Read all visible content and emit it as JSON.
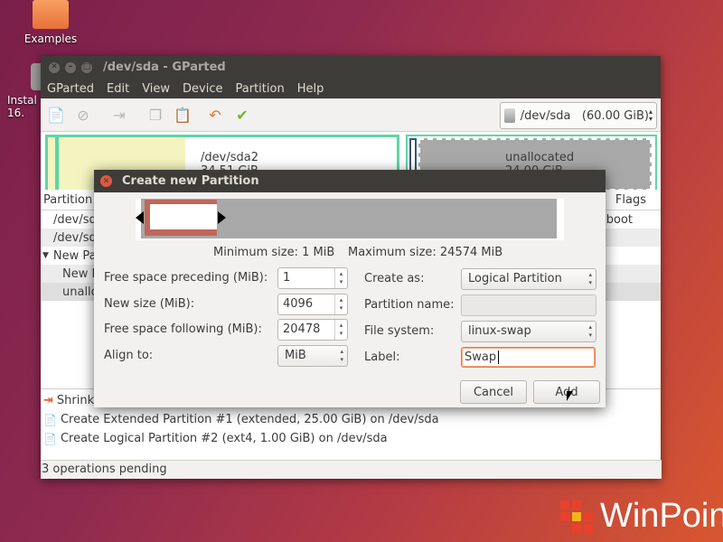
{
  "desktop": {
    "examples_label": "Examples",
    "install_label": "Instal\n16."
  },
  "window": {
    "title": "/dev/sda - GParted",
    "menu": [
      "GParted",
      "Edit",
      "View",
      "Device",
      "Partition",
      "Help"
    ],
    "device_selector": "/dev/sda   (60.00 GiB)",
    "diskmap": {
      "sda2_name": "/dev/sda2",
      "sda2_size": "34.51 GiB",
      "unalloc_name": "unallocated",
      "unalloc_size": "24.00 GiB"
    },
    "partition_list": {
      "col_partition": "Partition",
      "col_flags": "Flags",
      "rows": [
        {
          "name": "/dev/sd",
          "flags": "boot"
        },
        {
          "name": "/dev/sd",
          "flags": ""
        },
        {
          "name": "New Pa",
          "flags": ""
        },
        {
          "name": "New P",
          "flags": ""
        },
        {
          "name": "unallo",
          "flags": ""
        }
      ]
    },
    "operations": [
      "Shrink",
      "Create Extended Partition #1 (extended, 25.00 GiB) on /dev/sda",
      "Create Logical Partition #2 (ext4, 1.00 GiB) on /dev/sda"
    ],
    "status": "3 operations pending"
  },
  "dialog": {
    "title": "Create new Partition",
    "min_size": "Minimum size: 1 MiB",
    "max_size": "Maximum size: 24574 MiB",
    "free_before_label": "Free space preceding (MiB):",
    "free_before_value": "1",
    "new_size_label": "New size (MiB):",
    "new_size_value": "4096",
    "free_after_label": "Free space following (MiB):",
    "free_after_value": "20478",
    "align_label": "Align to:",
    "align_value": "MiB",
    "create_as_label": "Create as:",
    "create_as_value": "Logical Partition",
    "partition_name_label": "Partition name:",
    "partition_name_value": "",
    "filesystem_label": "File system:",
    "filesystem_value": "linux-swap",
    "label_label": "Label:",
    "label_value": "Swap",
    "cancel": "Cancel",
    "add": "Add"
  },
  "watermark": "WinPoin",
  "colors": {
    "titlebar": "#3d3c38",
    "sda2_fill": "#f4f4c0",
    "partition_border": "#5dd6a6",
    "unallocated_fill": "#a8a8a8",
    "swap_fill": "#c0665a",
    "focus_orange": "#f07746"
  }
}
